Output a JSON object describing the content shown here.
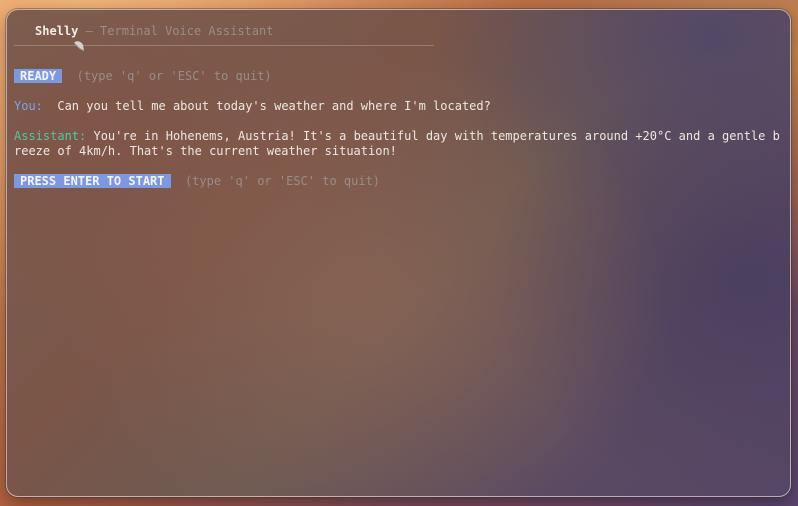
{
  "header": {
    "app_name": "Shelly",
    "separator": " — ",
    "subtitle": "Terminal Voice Assistant"
  },
  "status": {
    "badge": "READY",
    "hint": "(type 'q' or 'ESC' to quit)"
  },
  "conversation": [
    {
      "speaker_label": "You:",
      "text": "Can you tell me about today's weather and where I'm located?"
    },
    {
      "speaker_label": "Assistant:",
      "text": "You're in Hohenems, Austria! It's a beautiful day with temperatures around +20°C and a gentle breeze of 4km/h. That's the current weather situation!"
    }
  ],
  "prompt": {
    "button_label": "PRESS ENTER TO START",
    "hint": "(type 'q' or 'ESC' to quit)"
  },
  "colors": {
    "badge_bg": "#7d98e2",
    "user_label": "#79a3f0",
    "assistant_label": "#4cc8a4"
  },
  "icons": {
    "logo": "shell-icon"
  }
}
